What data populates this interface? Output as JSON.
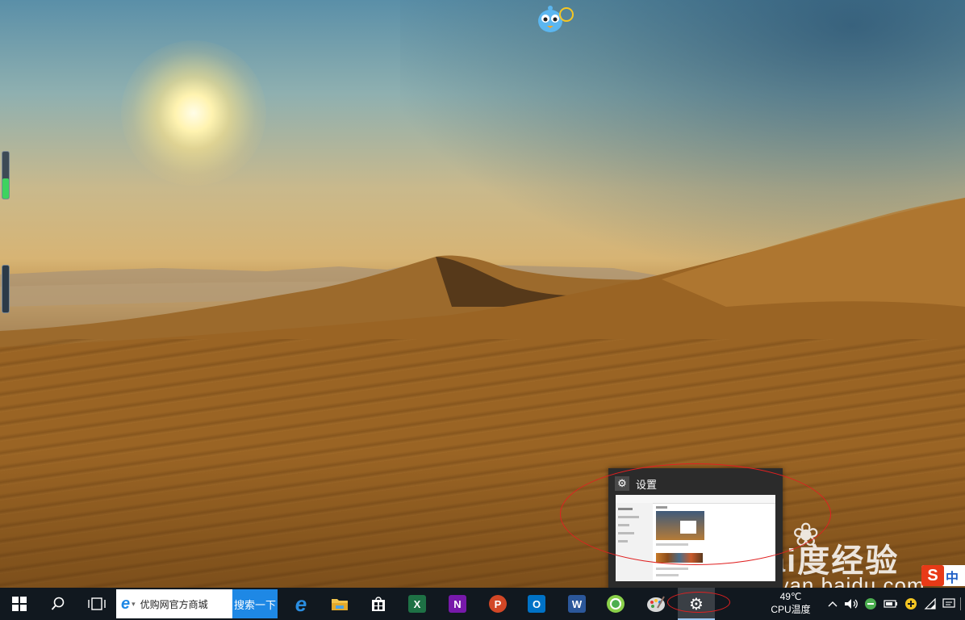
{
  "desktop": {
    "watermark_brand": "Bai度经验",
    "watermark_url": "jingyan.baidu.com",
    "gadget_level": 0.45
  },
  "ime": {
    "logo": "S",
    "label": "中"
  },
  "preview": {
    "title": "设置",
    "icon": "gear-icon"
  },
  "taskbar": {
    "start_icon": "windows-logo-icon",
    "search_icon": "search-icon",
    "taskview_icon": "task-view-icon",
    "ie_box_text": "优购网官方商城",
    "ie_search_label": "搜索一下",
    "apps": [
      {
        "name": "edge",
        "icon": "edge-icon"
      },
      {
        "name": "file-explorer",
        "icon": "folder-icon"
      },
      {
        "name": "store",
        "icon": "store-icon"
      },
      {
        "name": "excel",
        "icon": "excel-icon",
        "glyph": "X",
        "color": "#1e7145"
      },
      {
        "name": "onenote",
        "icon": "onenote-icon",
        "glyph": "N",
        "color": "#7719aa"
      },
      {
        "name": "powerpoint",
        "icon": "powerpoint-icon",
        "glyph": "P",
        "color": "#d24726"
      },
      {
        "name": "outlook",
        "icon": "outlook-icon",
        "glyph": "O",
        "color": "#0072c6"
      },
      {
        "name": "word",
        "icon": "word-icon",
        "glyph": "W",
        "color": "#2b579a"
      },
      {
        "name": "360-browser",
        "icon": "refresh-globe-icon"
      },
      {
        "name": "paint",
        "icon": "palette-icon"
      },
      {
        "name": "settings",
        "icon": "gear-icon"
      }
    ],
    "temperature": "49℃",
    "temperature_label": "CPU温度",
    "accent": "#1e88e5"
  }
}
